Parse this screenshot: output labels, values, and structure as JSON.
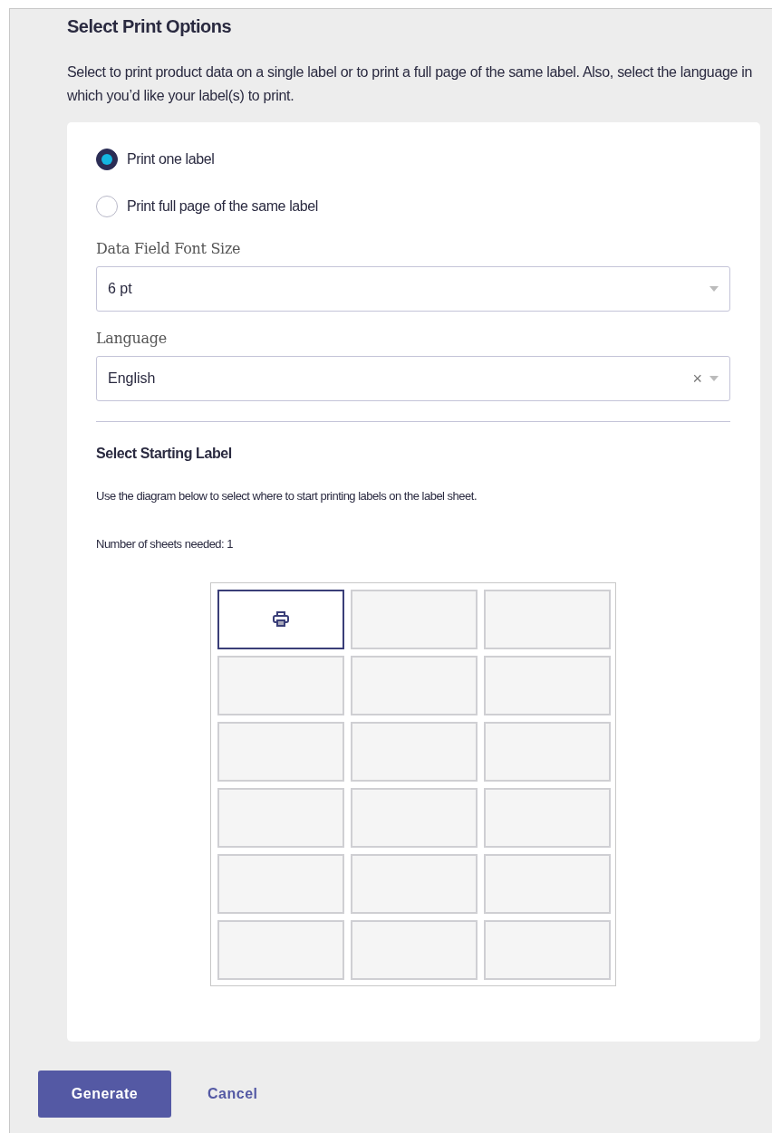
{
  "title": "Select Print Options",
  "description": "Select to print product data on a single label or to print a full page of the same label. Also, select the language in which you’d like your label(s) to print.",
  "print_mode": [
    {
      "label": "Print one label",
      "selected": true
    },
    {
      "label": "Print full page of the same label",
      "selected": false
    }
  ],
  "font_size": {
    "label": "Data Field Font Size",
    "value": "6 pt"
  },
  "language": {
    "label": "Language",
    "value": "English",
    "clear_icon": "×"
  },
  "starting_label": {
    "title": "Select Starting Label",
    "hint": "Use the diagram below to select where to start printing labels on the label sheet.",
    "sheets_needed": "Number of sheets needed: 1",
    "cells": [
      {
        "selected": true
      },
      {
        "selected": false
      },
      {
        "selected": false
      },
      {
        "selected": false
      },
      {
        "selected": false
      },
      {
        "selected": false
      },
      {
        "selected": false
      },
      {
        "selected": false
      },
      {
        "selected": false
      },
      {
        "selected": false
      },
      {
        "selected": false
      },
      {
        "selected": false
      },
      {
        "selected": false
      },
      {
        "selected": false
      },
      {
        "selected": false
      },
      {
        "selected": false
      },
      {
        "selected": false
      },
      {
        "selected": false
      }
    ]
  },
  "buttons": [
    {
      "label": "Generate",
      "kind": "primary"
    },
    {
      "label": "Cancel",
      "kind": "link"
    }
  ]
}
